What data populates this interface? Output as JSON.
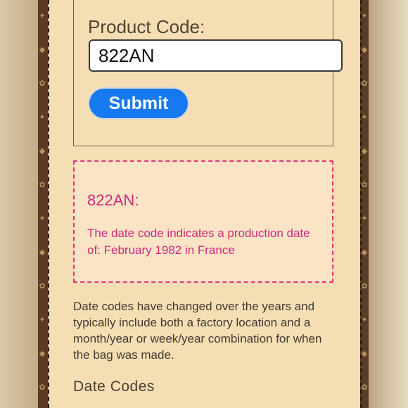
{
  "form": {
    "label": "Product Code:",
    "input_value": "822AN",
    "submit_label": "Submit"
  },
  "result": {
    "code_heading": "822AN:",
    "message": "The date code indicates a production date of: February 1982 in France"
  },
  "info": {
    "paragraph": "Date codes have changed over the years and typically include both a factory location and a month/year or week/year combination for when the bag was made."
  },
  "section": {
    "heading": "Date Codes"
  },
  "colors": {
    "page_background": "#f5deb3",
    "submit_button": "#1779f0",
    "result_accent": "#cc2a7b",
    "result_border": "#e0337a",
    "canvas_brown": "#5a3b25"
  }
}
